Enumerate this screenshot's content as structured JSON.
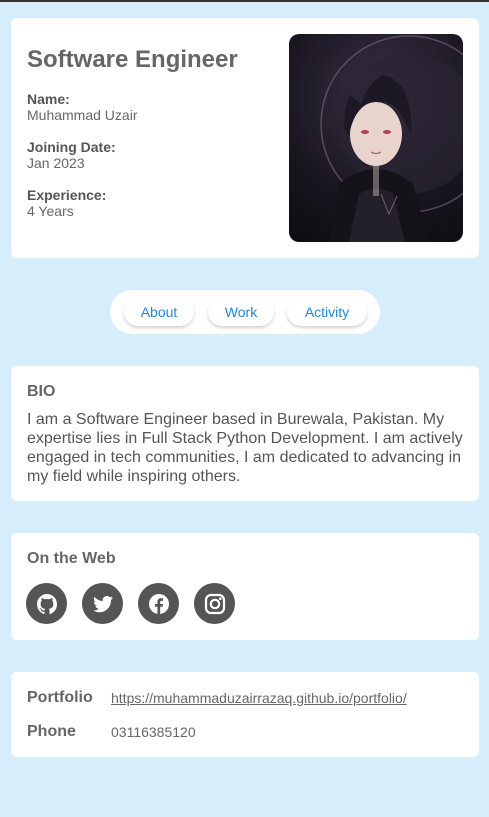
{
  "profile": {
    "title": "Software Engineer",
    "name_label": "Name:",
    "name_value": "Muhammad Uzair",
    "joining_label": "Joining Date:",
    "joining_value": "Jan 2023",
    "experience_label": "Experience:",
    "experience_value": "4 Years"
  },
  "tabs": [
    {
      "label": "About"
    },
    {
      "label": "Work"
    },
    {
      "label": "Activity"
    }
  ],
  "bio": {
    "title": "BIO",
    "text": "I am a Software Engineer based in Burewala, Pakistan. My expertise lies in Full Stack Python Development. I am actively engaged in tech communities, I am dedicated to advancing in my field while inspiring others."
  },
  "web": {
    "title": "On the Web",
    "icons": [
      "github-icon",
      "twitter-icon",
      "facebook-icon",
      "instagram-icon"
    ]
  },
  "contact": {
    "portfolio_label": "Portfolio",
    "portfolio_value": "https://muhammaduzairrazaq.github.io/portfolio/",
    "phone_label": "Phone",
    "phone_value": "03116385120"
  },
  "colors": {
    "page_background": "#d6eefc",
    "card_background": "#ffffff",
    "tab_text": "#1e88e5",
    "icon_background": "#555555"
  }
}
